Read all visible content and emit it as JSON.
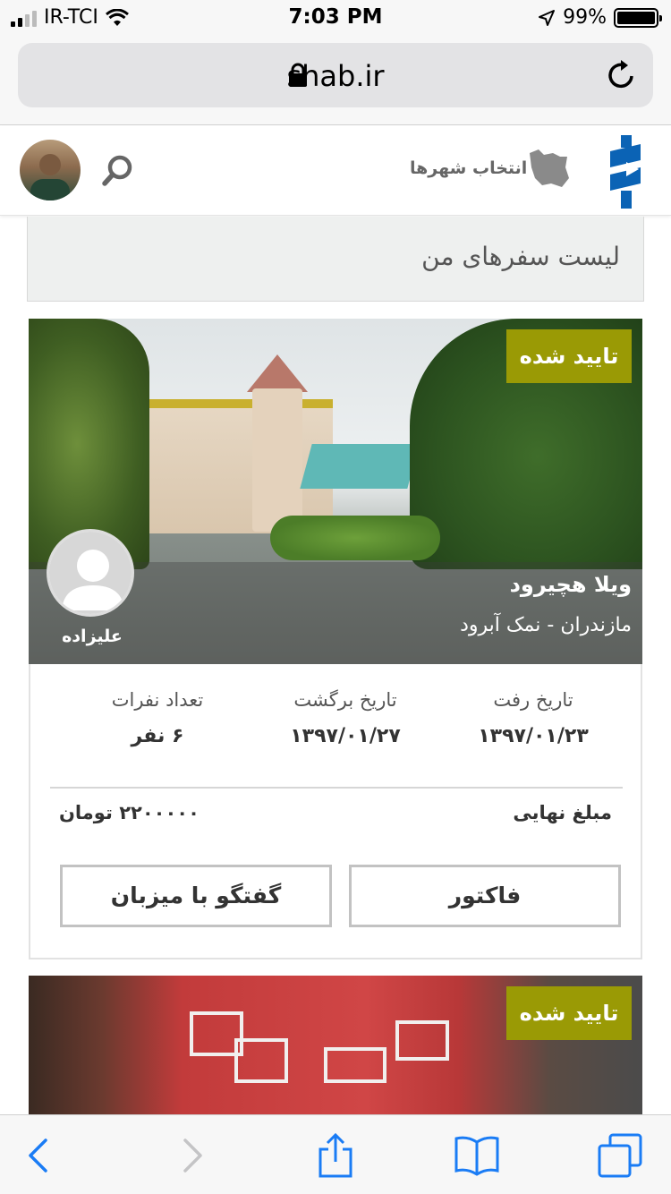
{
  "status_bar": {
    "carrier": "IR-TCI",
    "time": "7:03 PM",
    "battery": "99%",
    "signal_bars_filled": 2,
    "signal_bars_total": 4
  },
  "browser": {
    "url": "shab.ir",
    "icons": {
      "lock": "lock-icon",
      "reload": "reload-icon"
    }
  },
  "header": {
    "city_select_label": "انتخاب شهرها",
    "icons": {
      "search": "search-icon",
      "map": "iran-map-icon",
      "logo": "shab-logo"
    }
  },
  "page": {
    "title": "لیست سفرهای من"
  },
  "trips": [
    {
      "status": "تایید شده",
      "villa_name": "ویلا هچیرود",
      "location": "مازندران - نمک آبرود",
      "host_name": "علیزاده",
      "depart_label": "تاریخ رفت",
      "depart_date": "۱۳۹۷/۰۱/۲۳",
      "return_label": "تاریخ برگشت",
      "return_date": "۱۳۹۷/۰۱/۲۷",
      "guests_label": "تعداد نفرات",
      "guests_value": "۶ نفر",
      "final_amount_label": "مبلغ نهایی",
      "final_amount_value": "۲۲۰۰۰۰۰ تومان",
      "invoice_button": "فاکتور",
      "chat_button": "گفتگو با میزبان"
    },
    {
      "status": "تایید شده"
    }
  ],
  "colors": {
    "status_chip": "#9a9a05",
    "logo_blue": "#0b63b5",
    "ios_blue": "#1a7cf5"
  }
}
